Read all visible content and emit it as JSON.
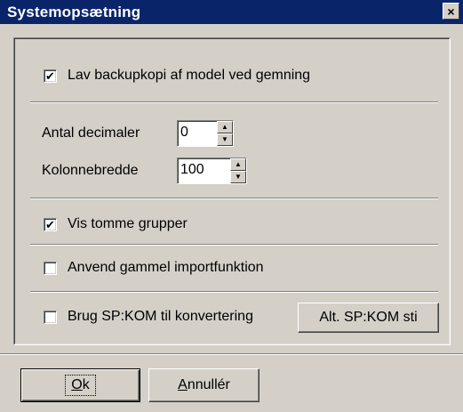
{
  "window": {
    "title": "Systemopsætning",
    "close_label": "×"
  },
  "options": {
    "backup": {
      "label": "Lav backupkopi af model ved gemning",
      "checked": true
    },
    "decimals": {
      "label": "Antal decimaler",
      "value": "0"
    },
    "colwidth": {
      "label": "Kolonnebredde",
      "value": "100"
    },
    "empty_groups": {
      "label": "Vis tomme grupper",
      "checked": true
    },
    "old_import": {
      "label": "Anvend gammel importfunktion",
      "checked": false
    },
    "spkom": {
      "label": "Brug SP:KOM til konvertering",
      "checked": false,
      "button": "Alt. SP:KOM sti"
    }
  },
  "check_glyph": "✔",
  "footer": {
    "ok_mnemonic": "O",
    "ok_rest": "k",
    "cancel_mnemonic": "A",
    "cancel_rest": "nnullér"
  }
}
